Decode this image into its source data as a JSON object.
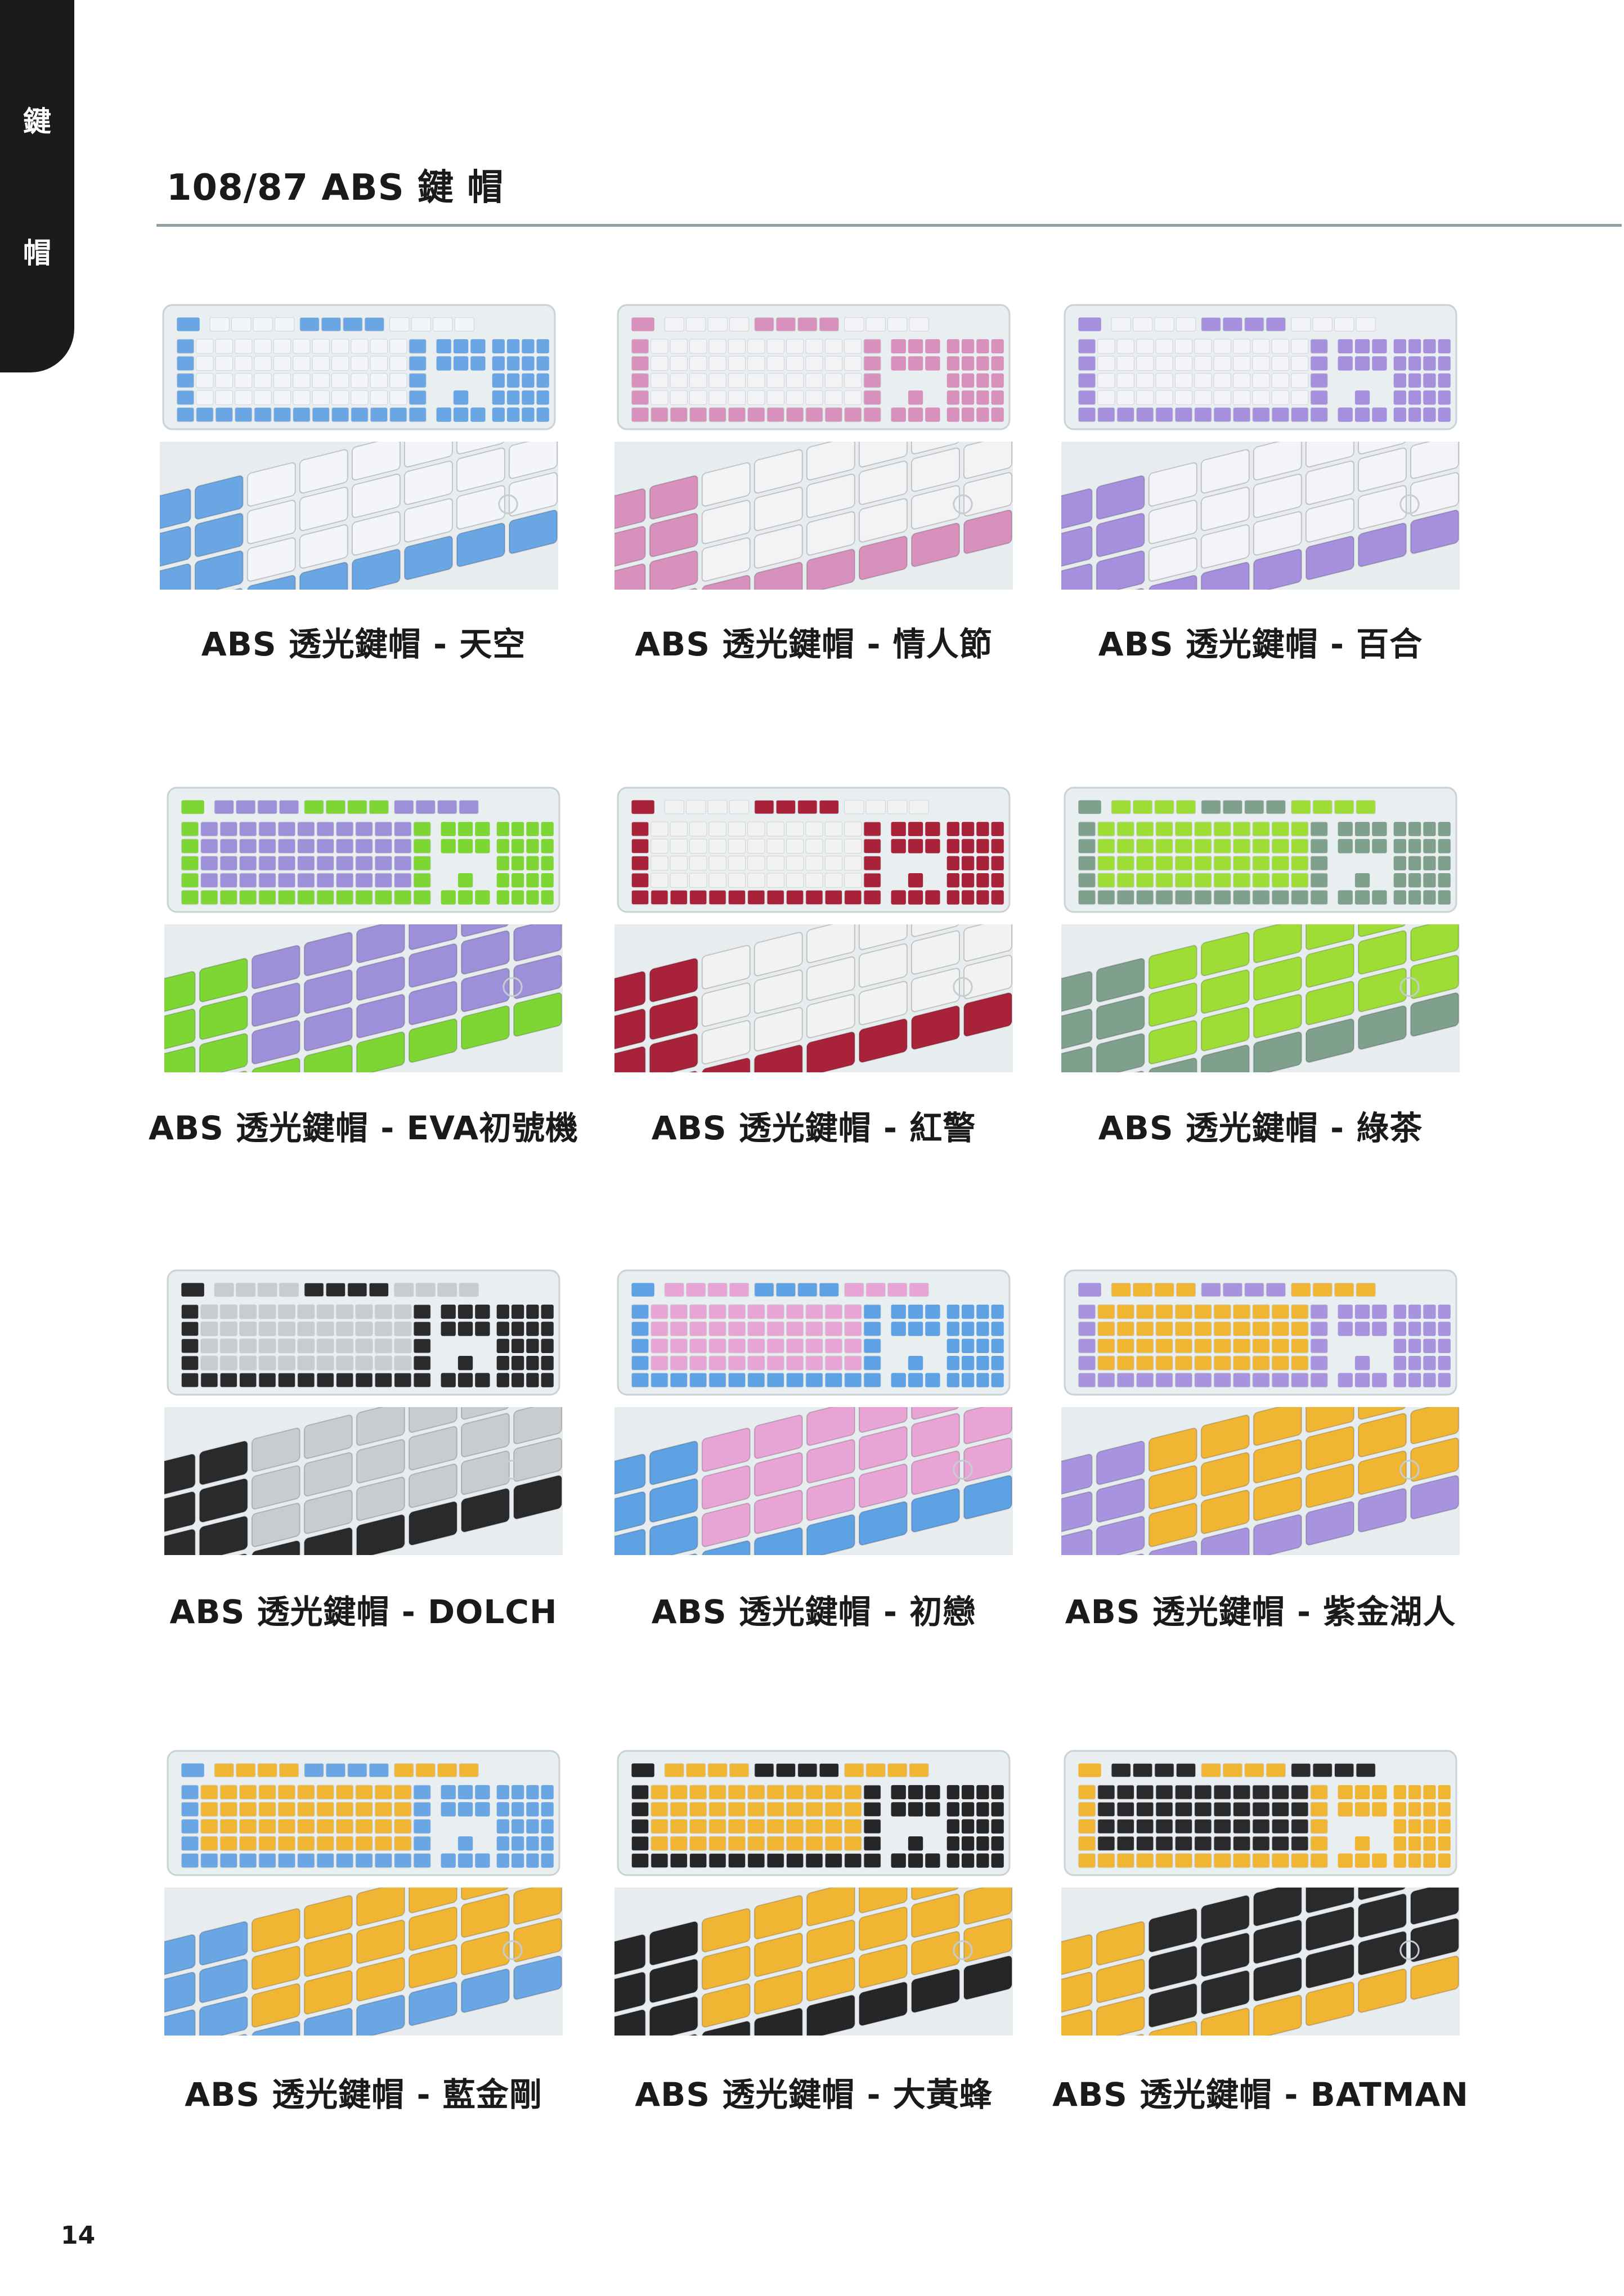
{
  "side_tab": {
    "chars": [
      "鍵",
      "帽"
    ]
  },
  "title": "108/87 ABS 鍵 帽",
  "page_number": "14",
  "products": [
    {
      "caption": "ABS 透光鍵帽 - 天空",
      "colors": {
        "main": "#f3f5f8",
        "accent": "#6aa6e3"
      }
    },
    {
      "caption": "ABS 透光鍵帽 - 情人節",
      "colors": {
        "main": "#f3f3f6",
        "accent": "#d891bd"
      }
    },
    {
      "caption": "ABS 透光鍵帽 - 百合",
      "colors": {
        "main": "#f3f3f8",
        "accent": "#a690dd"
      }
    },
    {
      "caption": "ABS 透光鍵帽 - EVA初號機",
      "colors": {
        "main": "#9d90d8",
        "accent": "#7ed635"
      }
    },
    {
      "caption": "ABS 透光鍵帽 - 紅警",
      "colors": {
        "main": "#f2f2f2",
        "accent": "#a8223a"
      }
    },
    {
      "caption": "ABS 透光鍵帽 - 綠茶",
      "colors": {
        "main": "#9edd35",
        "accent": "#7fa08c"
      }
    },
    {
      "caption": "ABS 透光鍵帽 - DOLCH",
      "colors": {
        "main": "#c9cccf",
        "accent": "#2a2a2c"
      }
    },
    {
      "caption": "ABS 透光鍵帽 - 初戀",
      "colors": {
        "main": "#e7a4d4",
        "accent": "#5fa2e3"
      }
    },
    {
      "caption": "ABS 透光鍵帽 - 紫金湖人",
      "colors": {
        "main": "#f1b534",
        "accent": "#a894de"
      }
    },
    {
      "caption": "ABS 透光鍵帽 - 藍金剛",
      "colors": {
        "main": "#f1b534",
        "accent": "#6aa6e3"
      }
    },
    {
      "caption": "ABS 透光鍵帽 - 大黃蜂",
      "colors": {
        "main": "#f1b534",
        "accent": "#262628"
      }
    },
    {
      "caption": "ABS 透光鍵帽 - BATMAN",
      "colors": {
        "main": "#2a2a2c",
        "accent": "#f1b534"
      }
    }
  ]
}
